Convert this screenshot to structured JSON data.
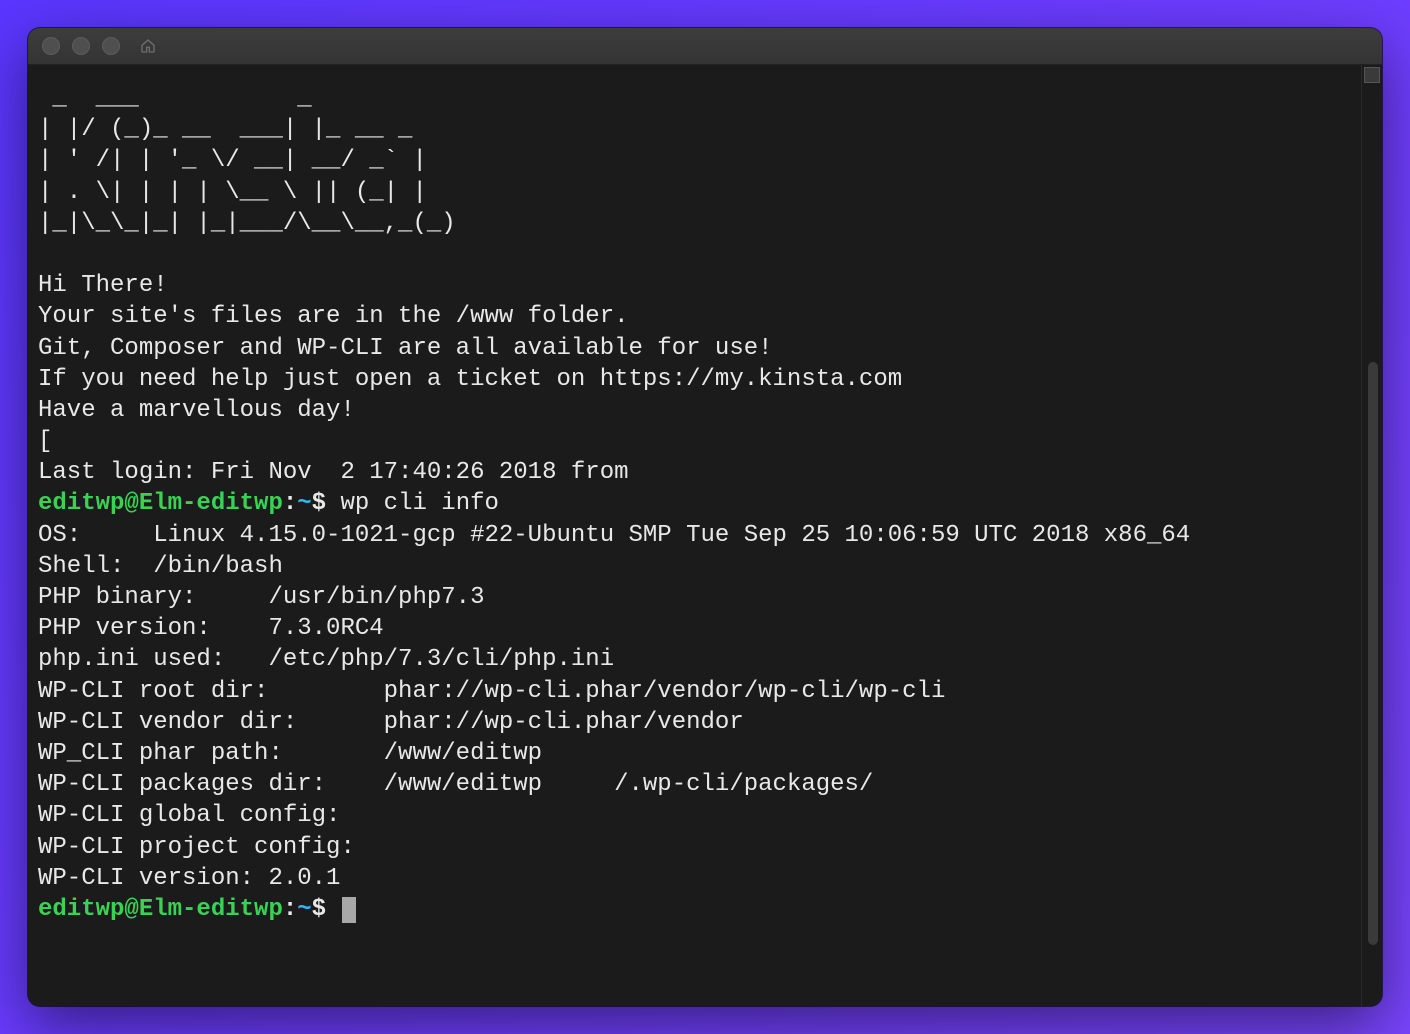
{
  "window": {
    "ascii_art": " _  ___           _        \n| |/ (_)_ __  ___| |_ __ _   \n| ' /| | '_ \\/ __| __/ _` |  \n| . \\| | | | \\__ \\ || (_| |  \n|_|\\_\\_|_| |_|___/\\__\\__,_(_)",
    "greeting": [
      "Hi There!",
      "Your site's files are in the /www folder.",
      "Git, Composer and WP-CLI are all available for use!",
      "If you need help just open a ticket on https://my.kinsta.com",
      "Have a marvellous day!"
    ],
    "bracket_left": "[",
    "bracket_right": "]",
    "last_login": "Last login: Fri Nov  2 17:40:26 2018 from",
    "prompt": {
      "userhost": "editwp@Elm-editwp",
      "sep": ":",
      "path": "~",
      "dollar": "$"
    },
    "command": "wp cli info",
    "output": [
      "OS:     Linux 4.15.0-1021-gcp #22-Ubuntu SMP Tue Sep 25 10:06:59 UTC 2018 x86_64",
      "Shell:  /bin/bash",
      "PHP binary:     /usr/bin/php7.3",
      "PHP version:    7.3.0RC4",
      "php.ini used:   /etc/php/7.3/cli/php.ini",
      "WP-CLI root dir:        phar://wp-cli.phar/vendor/wp-cli/wp-cli",
      "WP-CLI vendor dir:      phar://wp-cli.phar/vendor",
      "WP_CLI phar path:       /www/editwp",
      "WP-CLI packages dir:    /www/editwp     /.wp-cli/packages/",
      "WP-CLI global config:",
      "WP-CLI project config:",
      "WP-CLI version: 2.0.1"
    ]
  }
}
